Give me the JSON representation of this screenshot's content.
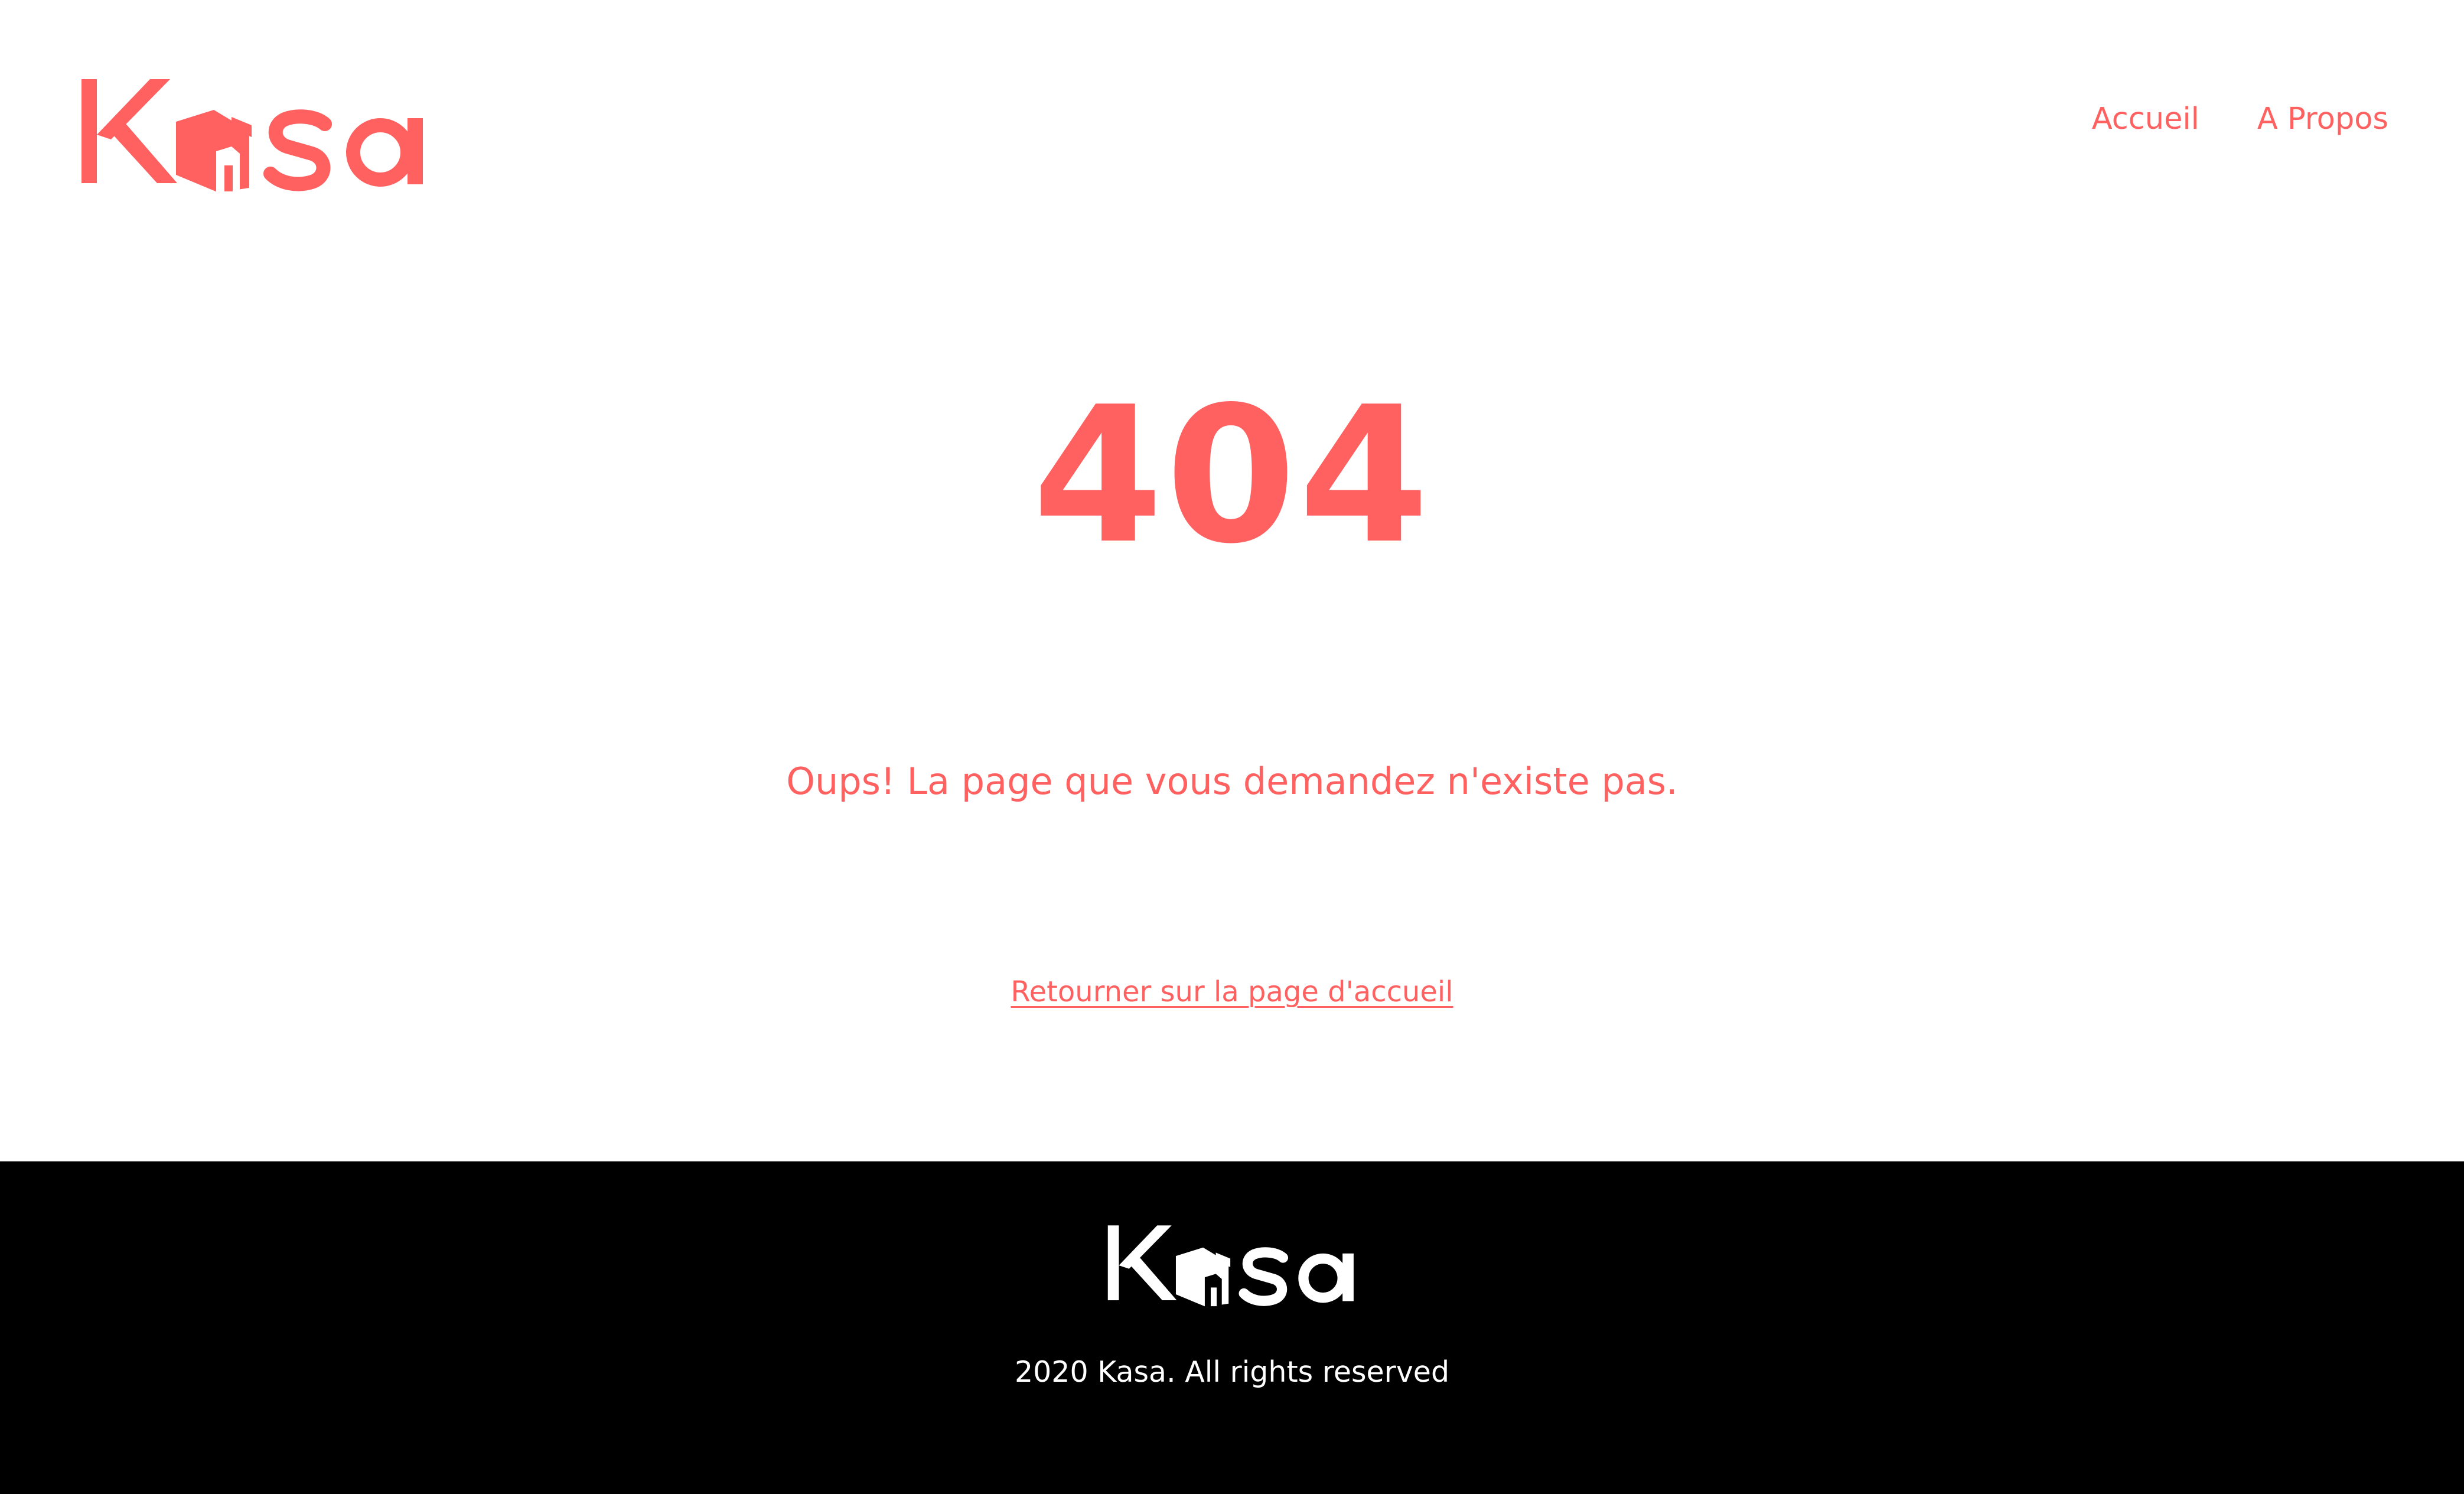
{
  "brand": {
    "logo_text": "Kasa",
    "accent_color": "#FF6060",
    "footer_background": "#000000",
    "footer_text_color": "#FFFFFF"
  },
  "nav": {
    "items": [
      {
        "label": "Accueil"
      },
      {
        "label": "A Propos"
      }
    ]
  },
  "main": {
    "error_code": "404",
    "message": "Oups! La page que vous demandez n'existe pas.",
    "back_link": "Retourner sur la page d'accueil"
  },
  "footer": {
    "logo_text": "Kasa",
    "copyright": "2020 Kasa. All rights reserved"
  }
}
